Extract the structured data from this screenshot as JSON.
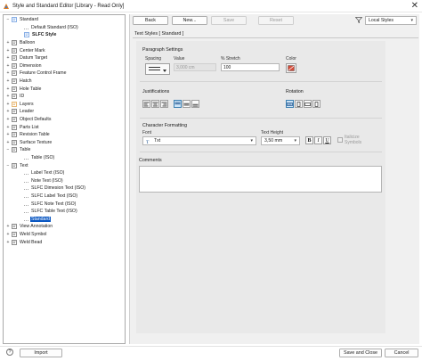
{
  "window": {
    "title": "Style and Standard Editor [Library - Read Only]",
    "close_glyph": "✕"
  },
  "tree": {
    "items": [
      {
        "label": "Standard",
        "indent": 0,
        "expander": "−",
        "icon": "standard-icon"
      },
      {
        "label": "Default Standard (ISO)",
        "indent": 2,
        "expander": "",
        "icon": ""
      },
      {
        "label": "SLFC Style",
        "indent": 2,
        "expander": "",
        "icon": "standard-doc-icon",
        "bold": true
      },
      {
        "label": "Balloon",
        "indent": 0,
        "expander": "+",
        "icon": "balloon-icon"
      },
      {
        "label": "Center Mark",
        "indent": 0,
        "expander": "+",
        "icon": "center-mark-icon"
      },
      {
        "label": "Datum Target",
        "indent": 0,
        "expander": "+",
        "icon": "datum-target-icon"
      },
      {
        "label": "Dimension",
        "indent": 0,
        "expander": "+",
        "icon": "dimension-icon"
      },
      {
        "label": "Feature Control Frame",
        "indent": 0,
        "expander": "+",
        "icon": "feature-control-frame-icon"
      },
      {
        "label": "Hatch",
        "indent": 0,
        "expander": "+",
        "icon": "hatch-icon"
      },
      {
        "label": "Hole Table",
        "indent": 0,
        "expander": "+",
        "icon": "hole-table-icon"
      },
      {
        "label": "ID",
        "indent": 0,
        "expander": "+",
        "icon": "id-icon"
      },
      {
        "label": "Layers",
        "indent": 0,
        "expander": "+",
        "icon": "layers-icon"
      },
      {
        "label": "Leader",
        "indent": 0,
        "expander": "+",
        "icon": "leader-icon"
      },
      {
        "label": "Object Defaults",
        "indent": 0,
        "expander": "+",
        "icon": "object-defaults-icon"
      },
      {
        "label": "Parts List",
        "indent": 0,
        "expander": "+",
        "icon": "parts-list-icon"
      },
      {
        "label": "Revision Table",
        "indent": 0,
        "expander": "+",
        "icon": "revision-table-icon"
      },
      {
        "label": "Surface Texture",
        "indent": 0,
        "expander": "+",
        "icon": "surface-texture-icon"
      },
      {
        "label": "Table",
        "indent": 0,
        "expander": "−",
        "icon": "table-icon"
      },
      {
        "label": "Table (ISO)",
        "indent": 2,
        "expander": "",
        "icon": ""
      },
      {
        "label": "Text",
        "indent": 0,
        "expander": "−",
        "icon": "text-icon"
      },
      {
        "label": "Label Text (ISO)",
        "indent": 2,
        "expander": "",
        "icon": ""
      },
      {
        "label": "Note Text (ISO)",
        "indent": 2,
        "expander": "",
        "icon": ""
      },
      {
        "label": "SLFC Dimesion Text (ISO)",
        "indent": 2,
        "expander": "",
        "icon": ""
      },
      {
        "label": "SLFC Label Text (ISO)",
        "indent": 2,
        "expander": "",
        "icon": ""
      },
      {
        "label": "SLFC Note Text (ISO)",
        "indent": 2,
        "expander": "",
        "icon": ""
      },
      {
        "label": "SLFC Table Text (ISO)",
        "indent": 2,
        "expander": "",
        "icon": ""
      },
      {
        "label": "Standard",
        "indent": 2,
        "expander": "",
        "icon": "",
        "selected": true
      },
      {
        "label": "View Annotation",
        "indent": 0,
        "expander": "+",
        "icon": "view-annotation-icon"
      },
      {
        "label": "Weld Symbol",
        "indent": 0,
        "expander": "+",
        "icon": "weld-symbol-icon"
      },
      {
        "label": "Weld Bead",
        "indent": 0,
        "expander": "+",
        "icon": "weld-bead-icon"
      }
    ]
  },
  "toolbar": {
    "back": "Back",
    "new": "New...",
    "save": "Save",
    "reset": "Reset",
    "filter_value": "Local Styles"
  },
  "panel": {
    "tab_title": "Text Styles [ Standard ]",
    "paragraph": {
      "heading": "Paragraph Settings",
      "spacing_label": "Spacing",
      "value_label": "Value",
      "value": "3,000 cm",
      "stretch_label": "% Stretch",
      "stretch": "100",
      "color_label": "Color"
    },
    "justifications_label": "Justifications",
    "rotation_label": "Rotation",
    "character": {
      "heading": "Character Formatting",
      "font_label": "Font",
      "font_value": "Txt",
      "height_label": "Text Height",
      "height_value": "3,50 mm",
      "bold": "B",
      "italic": "I",
      "underline": "U",
      "italicize_symbols": "Italicize Symbols"
    },
    "comments_label": "Comments"
  },
  "footer": {
    "help": "?",
    "import": "Import",
    "save_close": "Save and Close",
    "cancel": "Cancel"
  }
}
